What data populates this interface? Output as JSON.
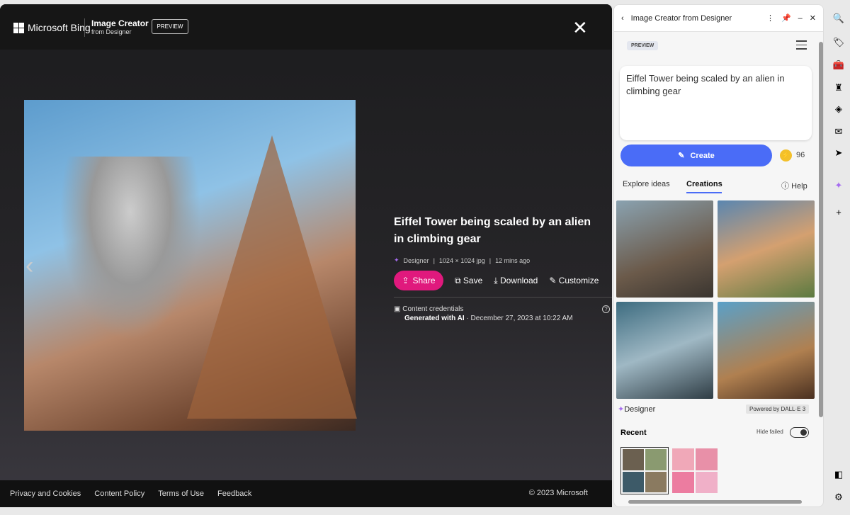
{
  "viewer": {
    "brand": "Microsoft Bing",
    "app_title": "Image Creator",
    "app_subtitle": "from Designer",
    "badge": "PREVIEW",
    "close_icon": "close-icon",
    "title": "Eiffel Tower being scaled by an alien in climbing gear",
    "meta": {
      "source": "Designer",
      "size": "1024 × 1024 jpg",
      "age": "12 mins ago"
    },
    "actions": {
      "share": "Share",
      "save": "Save",
      "download": "Download",
      "customize": "Customize"
    },
    "credentials": {
      "label": "Content credentials",
      "generated": "Generated with AI",
      "date": " · December 27, 2023 at 10:22 AM"
    },
    "footer": {
      "links": [
        "Privacy and Cookies",
        "Content Policy",
        "Terms of Use",
        "Feedback"
      ],
      "copyright": "© 2023 Microsoft"
    }
  },
  "panel": {
    "title": "Image Creator from Designer",
    "badge": "PREVIEW",
    "prompt": "Eiffel Tower being scaled by an alien in climbing gear",
    "create": "Create",
    "boosts": "96",
    "tabs": {
      "explore": "Explore ideas",
      "creations": "Creations",
      "help": "Help"
    },
    "designer": "Designer",
    "powered": "Powered by DALL·E 3",
    "recent": "Recent",
    "hide_failed": "Hide failed",
    "hide_failed_on": true
  },
  "colors": {
    "accent": "#4a6cf7",
    "share": "#e0197d"
  }
}
